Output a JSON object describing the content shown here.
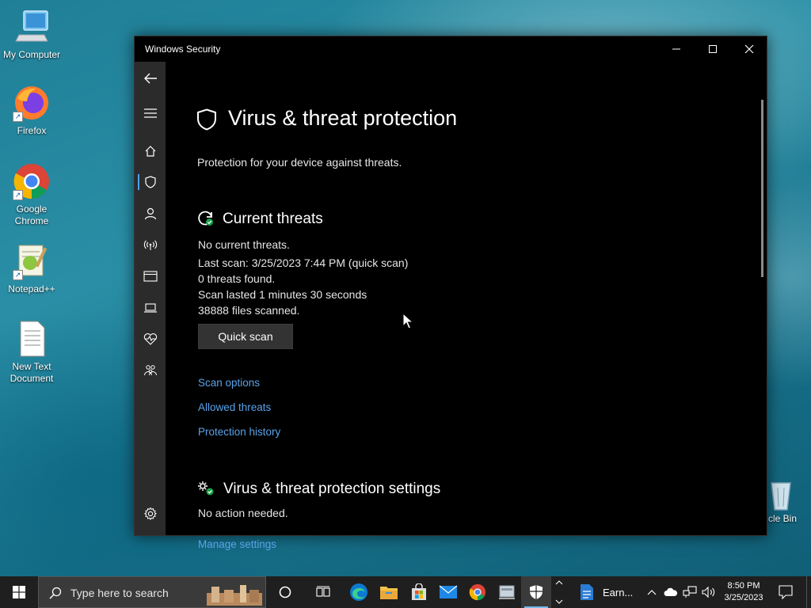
{
  "desktop": {
    "icons": [
      {
        "label": "My Computer"
      },
      {
        "label": "Firefox"
      },
      {
        "label": "Google Chrome"
      },
      {
        "label": "Notepad++"
      },
      {
        "label": "New Text Document"
      },
      {
        "label": "cle Bin"
      }
    ]
  },
  "window": {
    "title": "Windows Security",
    "page_title": "Virus & threat protection",
    "page_subtitle": "Protection for your device against threats.",
    "current_threats": {
      "heading": "Current threats",
      "status": "No current threats.",
      "last_scan": "Last scan: 3/25/2023 7:44 PM (quick scan)",
      "threats_found": "0 threats found.",
      "duration": "Scan lasted 1 minutes 30 seconds",
      "files_scanned": "38888 files scanned.",
      "quick_scan_label": "Quick scan",
      "links": [
        "Scan options",
        "Allowed threats",
        "Protection history"
      ]
    },
    "settings": {
      "heading": "Virus & threat protection settings",
      "status": "No action needed.",
      "manage_link": "Manage settings"
    }
  },
  "taskbar": {
    "search_placeholder": "Type here to search",
    "active_app_label": "Earn...",
    "time": "8:50 PM",
    "date": "3/25/2023"
  },
  "colors": {
    "link": "#5aa2e8",
    "nav_rail": "#2b2b2b",
    "window_bg": "#000000",
    "taskbar": "#1f1f1f"
  }
}
